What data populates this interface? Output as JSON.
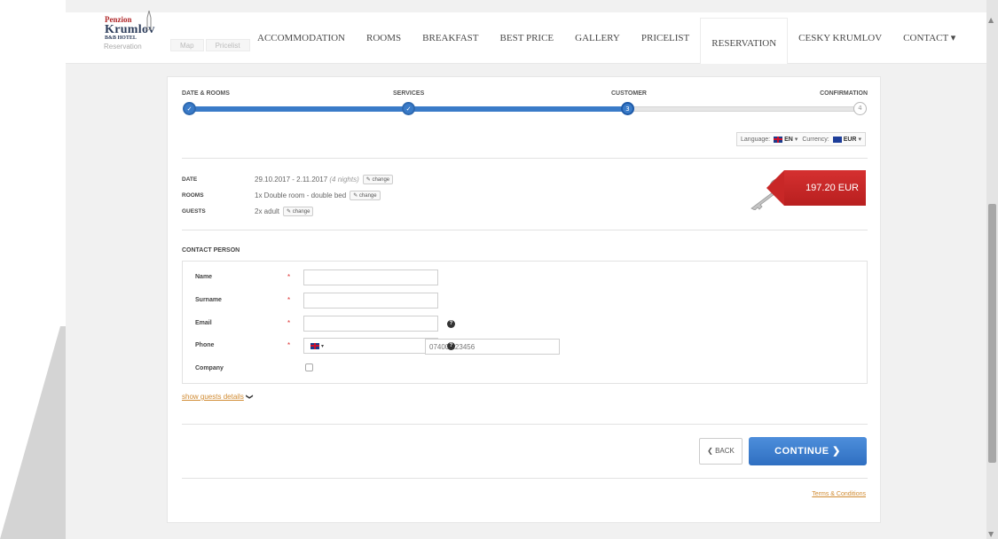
{
  "logo": {
    "line1": "Penzion",
    "line2": "Krumlov",
    "line3": "B&B HOTEL"
  },
  "subnav": {
    "first": "Reservation",
    "items": [
      "Map",
      "Pricelist"
    ]
  },
  "nav": {
    "items": [
      "ACCOMMODATION",
      "ROOMS",
      "BREAKFAST",
      "BEST PRICE",
      "GALLERY",
      "PRICELIST",
      "RESERVATION",
      "CESKY KRUMLOV",
      "CONTACT ▾"
    ],
    "active": "RESERVATION"
  },
  "steps": {
    "labels": [
      "DATE & ROOMS",
      "SERVICES",
      "CUSTOMER",
      "CONFIRMATION"
    ],
    "marks": [
      "✓",
      "✓",
      "3",
      "4"
    ],
    "current": 3
  },
  "locale": {
    "language_label": "Language:",
    "language_value": "EN",
    "currency_label": "Currency:",
    "currency_value": "EUR"
  },
  "summary": {
    "date_label": "DATE",
    "date_value": "29.10.2017 - 2.11.2017",
    "date_nights": "(4 nights)",
    "rooms_label": "ROOMS",
    "rooms_value": "1x Double room - double bed",
    "guests_label": "GUESTS",
    "guests_value": "2x adult",
    "change_label": "change",
    "price": "197.20 EUR"
  },
  "contact": {
    "title": "CONTACT PERSON",
    "name_label": "Name",
    "surname_label": "Surname",
    "email_label": "Email",
    "phone_label": "Phone",
    "company_label": "Company",
    "required_mark": "*",
    "phone_placeholder": "07400 123456",
    "phone_country_caret": "▾"
  },
  "show_guests": "show guests details",
  "buttons": {
    "back": "❮ BACK",
    "continue": "CONTINUE ❯"
  },
  "terms": "Terms & Conditions",
  "colors": {
    "accent": "#3a7bc8",
    "price_tag": "#c82727",
    "link": "#d08a30"
  }
}
